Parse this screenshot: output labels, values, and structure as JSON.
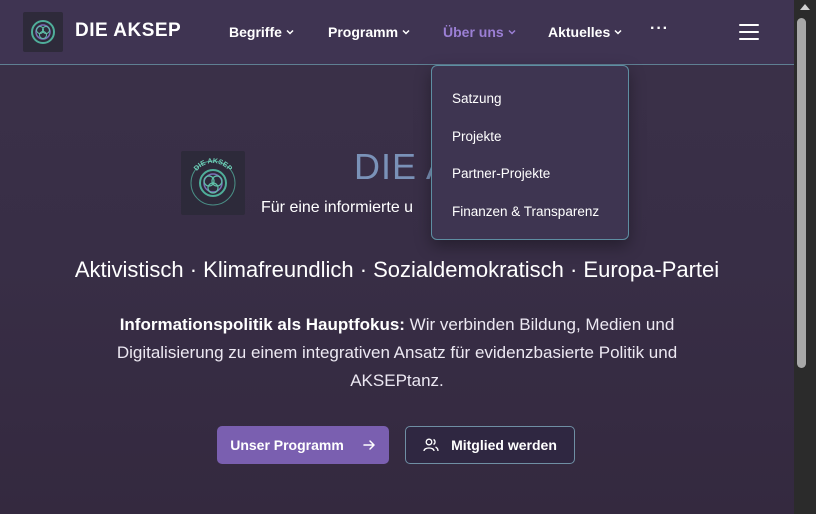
{
  "nav": {
    "brand": "DIE AKSEP",
    "items": [
      {
        "label": "Begriffe"
      },
      {
        "label": "Programm"
      },
      {
        "label": "Über uns"
      },
      {
        "label": "Aktuelles"
      }
    ],
    "more": "···"
  },
  "dropdown": {
    "items": [
      "Satzung",
      "Projekte",
      "Partner-Projekte",
      "Finanzen & Transparenz"
    ]
  },
  "hero": {
    "title": "DIE AKSEP",
    "subtitle": "Für eine informierte u",
    "tagline": "Aktivistisch · Klimafreundlich · Sozialdemokratisch · Europa-Partei",
    "desc_bold": "Informationspolitik als Hauptfokus:",
    "desc_text": " Wir verbinden Bildung, Medien und Digitalisierung zu einem integrativen Ansatz für evidenzbasierte Politik und AKSEPtanz.",
    "logo_text": "DIE AKSEP"
  },
  "buttons": {
    "primary": "Unser Programm",
    "secondary": "Mitglied werden"
  },
  "colors": {
    "accent": "#7a5fb0",
    "active_nav": "#9b7fd4",
    "border": "#5e8ea2"
  }
}
